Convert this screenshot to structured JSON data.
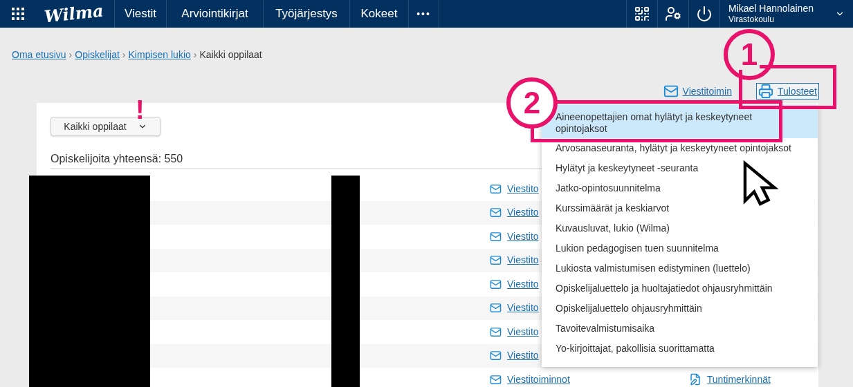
{
  "header": {
    "logo": "Wilma",
    "nav": [
      {
        "label": "Viestit"
      },
      {
        "label": "Arviointikirjat"
      },
      {
        "label": "Työjärjestys"
      },
      {
        "label": "Kokeet"
      }
    ],
    "more": "•••",
    "user": {
      "name": "Mikael Hannolainen",
      "org": "Virastokoulu"
    }
  },
  "breadcrumb_separator": "›",
  "breadcrumb": [
    {
      "label": "Oma etusivu",
      "link": true
    },
    {
      "label": "Opiskelijat",
      "link": true
    },
    {
      "label": "Kimpisen lukio",
      "link": true
    },
    {
      "label": "Kaikki oppilaat",
      "link": false
    }
  ],
  "actions": [
    {
      "kind": "mail",
      "label": "Viestitoimin",
      "focused": false
    },
    {
      "kind": "print",
      "label": "Tulosteet",
      "focused": true
    }
  ],
  "filter": {
    "value": "Kaikki oppilaat"
  },
  "count": "Opiskelijoita yhteensä: 550",
  "rows": [
    {
      "message_link": "Viestito"
    },
    {
      "message_link": "Viestito"
    },
    {
      "message_link": "Viestito"
    },
    {
      "message_link": "Viestito"
    },
    {
      "message_link": "Viestito"
    },
    {
      "message_link": "Viestito"
    },
    {
      "message_link": "Viestito"
    },
    {
      "message_link": "Viestito"
    },
    {
      "message_link": "Viestitoiminnot",
      "entries_link": "Tuntimerkinnät"
    }
  ],
  "menu": {
    "items": [
      {
        "label": "Aineenopettajien omat hylätyt ja keskeytyneet opintojaksot",
        "selected": true
      },
      {
        "label": "Arvosanaseuranta, hylätyt ja keskeytyneet opintojaksot",
        "selected": false
      },
      {
        "label": "Hylätyt ja keskeytyneet -seuranta",
        "selected": false
      },
      {
        "label": "Jatko-opintosuunnitelma",
        "selected": false
      },
      {
        "label": "Kurssimäärät ja keskiarvot",
        "selected": false
      },
      {
        "label": "Kuvausluvat, lukio (Wilma)",
        "selected": false
      },
      {
        "label": "Lukion pedagogisen tuen suunnitelma",
        "selected": false
      },
      {
        "label": "Lukiosta valmistumisen edistyminen (luettelo)",
        "selected": false
      },
      {
        "label": "Opiskelijaluettelo ja huoltajatiedot ohjausryhmittäin",
        "selected": false
      },
      {
        "label": "Opiskelijaluettelo ohjausryhmittäin",
        "selected": false
      },
      {
        "label": "Tavoitevalmistumisaika",
        "selected": false
      },
      {
        "label": "Yo-kirjoittajat, pakollisia suorittamatta",
        "selected": false
      }
    ]
  },
  "annotations": {
    "step_1": "1",
    "step_2": "2",
    "warning": "!"
  }
}
